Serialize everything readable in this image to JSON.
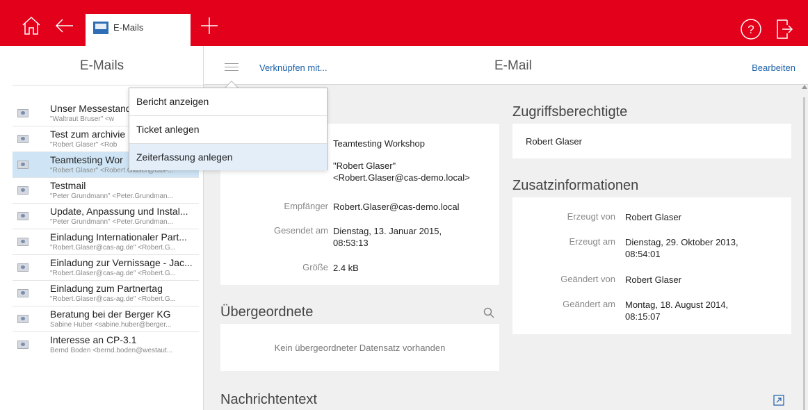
{
  "topbar": {
    "tab_label": "E-Mails",
    "accent_color": "#e3001b",
    "icons": [
      "home-icon",
      "back-arrow-icon",
      "mail-icon",
      "plus-icon",
      "help-icon",
      "logout-icon"
    ]
  },
  "left": {
    "title": "E-Mails",
    "items": [
      {
        "subject": "Unser Messestand",
        "sender": "\"Waltraut Bruser\" <w"
      },
      {
        "subject": "Test zum archivie",
        "sender": "\"Robert Glaser\" <Rob"
      },
      {
        "subject": "Teamtesting Wor",
        "sender": "\"Robert Glaser\" <Robert.Glaser@cas-..."
      },
      {
        "subject": "Testmail",
        "sender": "\"Peter Grundmann\" <Peter.Grundman..."
      },
      {
        "subject": "Update, Anpassung und Instal...",
        "sender": "\"Peter Grundmann\" <Peter.Grundman..."
      },
      {
        "subject": "Einladung Internationaler Part...",
        "sender": "\"Robert.Glaser@cas-ag.de\" <Robert.G..."
      },
      {
        "subject": "Einladung zur Vernissage - Jac...",
        "sender": "\"Robert.Glaser@cas-ag.de\" <Robert.G..."
      },
      {
        "subject": "Einladung zum Partnertag",
        "sender": "\"Robert.Glaser@cas-ag.de\" <Robert.G..."
      },
      {
        "subject": "Beratung bei der Berger KG",
        "sender": "Sabine Huber <sabine.huber@berger..."
      },
      {
        "subject": "Interesse an CP-3.1",
        "sender": "Bernd Boden <bernd.boden@westaut..."
      }
    ]
  },
  "header": {
    "link_label": "Verknüpfen mit...",
    "title": "E-Mail",
    "edit_label": "Bearbeiten"
  },
  "dropdown": {
    "items": [
      "Bericht anzeigen",
      "Ticket anlegen",
      "Zeiterfassung anlegen"
    ]
  },
  "details": {
    "subject_value": "Teamtesting Workshop",
    "from_value_1": "\"Robert Glaser\"",
    "from_value_2": "<Robert.Glaser@cas-demo.local>",
    "to_label": "Empfänger",
    "to_value": "Robert.Glaser@cas-demo.local",
    "sent_label": "Gesendet am",
    "sent_value_1": "Dienstag, 13. Januar 2015,",
    "sent_value_2": "08:53:13",
    "size_label": "Größe",
    "size_value": "2.4 kB"
  },
  "parent": {
    "title": "Übergeordnete",
    "empty_text": "Kein übergeordneter Datensatz vorhanden"
  },
  "message": {
    "title": "Nachrichtentext"
  },
  "access": {
    "title": "Zugriffsberechtigte",
    "value": "Robert Glaser"
  },
  "extra": {
    "title": "Zusatzinformationen",
    "created_by_label": "Erzeugt von",
    "created_by_value": "Robert Glaser",
    "created_at_label": "Erzeugt am",
    "created_at_value_1": "Dienstag, 29. Oktober 2013,",
    "created_at_value_2": "08:54:01",
    "changed_by_label": "Geändert von",
    "changed_by_value": "Robert Glaser",
    "changed_at_label": "Geändert am",
    "changed_at_value_1": "Montag, 18. August 2014,",
    "changed_at_value_2": "08:15:07"
  }
}
